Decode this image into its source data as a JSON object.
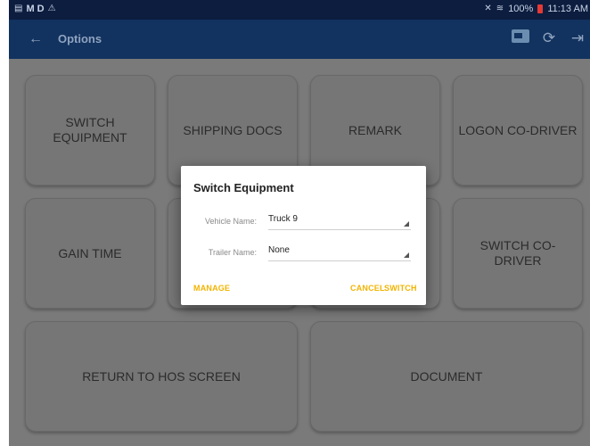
{
  "status_bar": {
    "left_icons": [
      "sim-icon",
      "M",
      "D",
      "wifi-icon"
    ],
    "left_text": "M D",
    "battery_text": "100%",
    "time": "11:13 AM"
  },
  "app_bar": {
    "title": "Options",
    "back_icon": "back-arrow-icon",
    "actions": [
      "truck-icon",
      "refresh-icon",
      "logout-icon"
    ]
  },
  "tiles": [
    {
      "label": "SWITCH EQUIPMENT"
    },
    {
      "label": "SHIPPING DOCS"
    },
    {
      "label": "REMARK"
    },
    {
      "label": "LOGON CO-DRIVER"
    },
    {
      "label": "GAIN TIME"
    },
    {
      "label": "SWITCH CO-DRIVER"
    },
    {
      "label": "RETURN TO HOS SCREEN"
    },
    {
      "label": "DOCUMENT"
    }
  ],
  "dialog": {
    "title": "Switch Equipment",
    "vehicle_label": "Vehicle Name:",
    "vehicle_value": "Truck 9",
    "trailer_label": "Trailer Name:",
    "trailer_value": "None",
    "manage_label": "MANAGE",
    "cancel_label": "CANCEL",
    "switch_label": "SWITCH"
  },
  "colors": {
    "status_bar": "#0c1d3f",
    "app_bar": "#12325f",
    "dialog_button": "#f2b400",
    "battery": "#e53935"
  }
}
